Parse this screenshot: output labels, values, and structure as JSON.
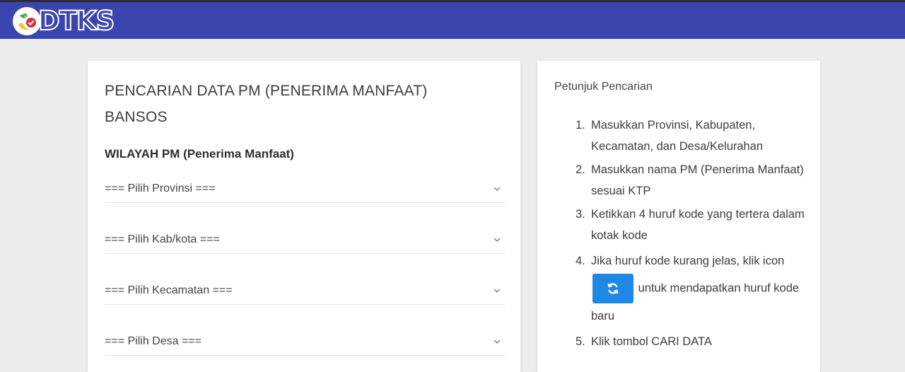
{
  "header": {
    "logo_text": "DTKS",
    "brand_color": "#3b45ae"
  },
  "search_card": {
    "title": "PENCARIAN DATA PM (PENERIMA MANFAAT) BANSOS",
    "region_heading": "WILAYAH PM (Penerima Manfaat)",
    "selects": [
      {
        "label": "=== Pilih Provinsi ===",
        "icon": "chevron-down-icon"
      },
      {
        "label": "=== Pilih Kab/kota ===",
        "icon": "chevron-down-icon"
      },
      {
        "label": "=== Pilih Kecamatan ===",
        "icon": "chevron-down-icon"
      },
      {
        "label": "=== Pilih Desa ===",
        "icon": "chevron-down-icon"
      }
    ]
  },
  "help_card": {
    "title": "Petunjuk Pencarian",
    "steps": [
      {
        "num": "1.",
        "text": "Masukkan Provinsi, Kabupaten, Kecamatan, dan Desa/Kelurahan"
      },
      {
        "num": "2.",
        "text": "Masukkan nama PM (Penerima Manfaat) sesuai KTP"
      },
      {
        "num": "3.",
        "text": "Ketikkan 4 huruf kode yang tertera dalam kotak kode"
      },
      {
        "num": "4.",
        "text_before": "Jika huruf kode kurang jelas, klik icon",
        "text_after": "untuk mendapatkan huruf kode baru",
        "icon": "refresh-icon",
        "button_color": "#1e88e5"
      },
      {
        "num": "5.",
        "text": "Klik tombol CARI DATA"
      }
    ]
  }
}
